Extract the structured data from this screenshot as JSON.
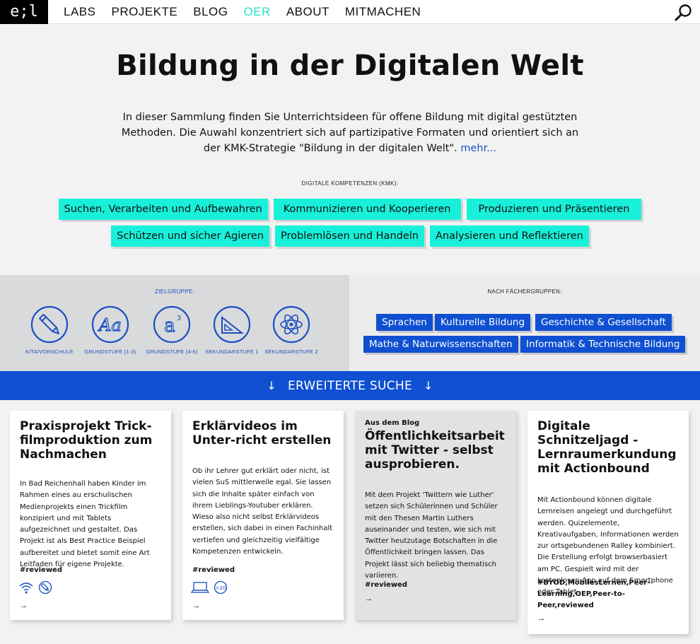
{
  "nav": {
    "logo": "e;l",
    "items": [
      "LABS",
      "PROJEKTE",
      "BLOG",
      "OER",
      "ABOUT",
      "MITMACHEN"
    ],
    "active": "OER",
    "accent_color": "#2de0d1"
  },
  "hero": {
    "title": "Bildung in der Digitalen Welt",
    "text": "In dieser Sammlung finden Sie Unterrichtsideen für offene Bildung mit digital gestützten Methoden. Die Auwahl konzentriert sich auf partizipative Formaten und orientiert sich an der KMK-Strategie \"Bildung in der digitalen Welt\".",
    "more_link": "mehr..."
  },
  "kmk": {
    "label": "DIGITALE KOMPETENZEN (KMK):",
    "chip_color": "#19f0d9",
    "row1": [
      "Suchen, Verarbeiten und Aufbewahren",
      "Kommunizieren und Kooperieren",
      "Produzieren und Präsentieren"
    ],
    "row2": [
      "Schützen und sicher Agieren",
      "Problemlösen und Handeln",
      "Analysieren und Reflektieren"
    ]
  },
  "audience": {
    "label": "ZIELGRUPPE:",
    "items": [
      {
        "icon": "crayon-icon",
        "label": "KITA/VORSCHULE"
      },
      {
        "icon": "letters-icon",
        "label": "GRUNDSTUFE (1-3)"
      },
      {
        "icon": "exponent-icon",
        "label": "GRUNDSTUFE (4-6)"
      },
      {
        "icon": "triangle-ruler-icon",
        "label": "SEKUNDARSTUFE 1"
      },
      {
        "icon": "atom-icon",
        "label": "SEKUNDARSTUFE 2"
      }
    ]
  },
  "subjects": {
    "label": "NACH FÄCHERGRUPPEN:",
    "color": "#0f4fd1",
    "items": [
      "Sprachen",
      "Kulturelle Bildung",
      "Geschichte & Gesellschaft",
      "Mathe & Naturwissenschaften",
      "Informatik & Technische Bildung"
    ]
  },
  "advanced_search": {
    "label": "ERWEITERTE SUCHE",
    "arrow": "↓"
  },
  "cards": [
    {
      "kicker": "",
      "title": "Praxisprojekt Trick-filmproduktion zum Nachmachen",
      "body": "In Bad Reichenhall haben Kinder im Rahmen eines au  erschulischen Medienprojekts einen Trickfilm konzipiert und mit Tablets aufgezeichnet und gestaltet. Das Projekt ist als Best Practice Beispiel aufbereitet und bietet somit eine Art Leitfaden für eigene Projekte.",
      "tag": "#reviewed",
      "icons": [
        "wifi-icon",
        "crayon-icon"
      ],
      "arrow": "→"
    },
    {
      "kicker": "",
      "title": "Erklärvideos im Unter-richt erstellen",
      "body": "Ob ihr Lehrer gut erklärt oder nicht, ist vielen SuS mittlerweile egal. Sie lassen sich die Inhalte später einfach von ihrem Lieblings-Youtuber erklären. Wieso also nicht selbst Erklärvideos erstellen, sich dabei in einen Fachinhalt vertiefen und gleichzeitig vielfältige Kompetenzen entwickeln.",
      "tag": "#reviewed",
      "icons": [
        "laptop-icon",
        "group-size-icon"
      ],
      "badge": ">20",
      "arrow": "→"
    },
    {
      "kicker": "Aus dem Blog",
      "title": "Öffentlichkeitsarbeit mit Twitter - selbst ausprobieren.",
      "body": "Mit dem Projekt 'Twittern wie Luther' setzen sich Schülerinnen und Schüler mit den Thesen Martin Luthers auseinander und testen, wie sich mit Twitter heutzutage Botschaften in die Öffentlichkeit bringen lassen. Das Projekt lässt sich beliebig thematisch variieren.",
      "tag": "#reviewed",
      "icons": [],
      "arrow": "→"
    },
    {
      "kicker": "",
      "title": "Digitale Schnitzeljagd - Lernraumerkundung mit Actionbound",
      "body": "Mit Actionbound können digitale Lernreisen angelegt und durchgeführt werden. Quizelemente, Kreativaufgaben, Informationen werden zur ortsgebundenen Ralley kombiniert. Die Erstellung erfolgt browserbasiert am PC. Gespielt wird mit der kostenlosen App auf dem Smartphone oder Tablet.",
      "tag": "#BYOD,MobilesLernen,Peer-Learning,OEP,Peer-to-Peer,reviewed",
      "icons": [],
      "arrow": "→"
    }
  ]
}
